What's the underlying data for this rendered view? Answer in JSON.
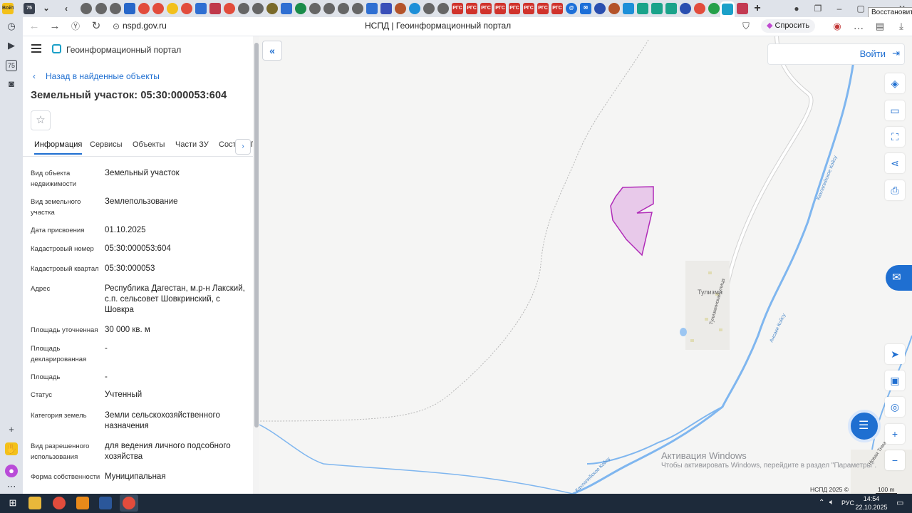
{
  "browser": {
    "url": "nspd.gov.ru",
    "page_title": "НСПД | Геоинформационный портал",
    "ask_button": "Спросить",
    "restore_tooltip": "Восстановить",
    "badge_text": "75",
    "login_small": "Войти"
  },
  "portal": {
    "name": "Геоинформационный портал",
    "back_link": "Назад в найденные объекты",
    "title": "Земельный участок: 05:30:000053:604",
    "tabs": [
      "Информация",
      "Сервисы",
      "Объекты",
      "Части ЗУ",
      "Соста",
      "П"
    ],
    "properties": [
      {
        "label": "Вид объекта недвижимости",
        "value": "Земельный участок"
      },
      {
        "label": "Вид земельного участка",
        "value": "Землепользование"
      },
      {
        "label": "Дата присвоения",
        "value": "01.10.2025"
      },
      {
        "label": "Кадастровый номер",
        "value": "05:30:000053:604"
      },
      {
        "label": "Кадастровый квартал",
        "value": "05:30:000053"
      },
      {
        "label": "Адрес",
        "value": "Республика Дагестан, м.р-н Лакский, с.п. сельсовет Шовкринский, с Шовкра"
      },
      {
        "label": "Площадь уточненная",
        "value": "30 000 кв. м"
      },
      {
        "label": "Площадь декларированная",
        "value": "-"
      },
      {
        "label": "Площадь",
        "value": "-"
      },
      {
        "label": "Статус",
        "value": "Учтенный"
      },
      {
        "label": "Категория земель",
        "value": "Земли сельскохозяйственного назначения"
      },
      {
        "label": "Вид разрешенного использования",
        "value": "для ведения личного подсобного хозяйства"
      },
      {
        "label": "Форма собственности",
        "value": "Муниципальная"
      }
    ]
  },
  "map": {
    "login": "Войти",
    "village_label": "Тулизма",
    "street_label": "Тулизминская улица",
    "river_label_1": "Кахлапийское Койсу",
    "river_label_2": "Ансаки Койсу",
    "river_label_3": "Новая Тима",
    "copyright": "НСПД 2025 ©",
    "scale": "100 m",
    "watermark_title": "Активация Windows",
    "watermark_text": "Чтобы активировать Windows, перейдите в раздел \"Параметры\".",
    "parcel_fill": "#e8c9ea",
    "parcel_stroke": "#b02bb8"
  },
  "taskbar": {
    "time": "14:54",
    "date": "22.10.2025",
    "lang": "РУС"
  },
  "colors": {
    "accent": "#1f6fd1",
    "river": "#7fb6ef",
    "taskbar": "#1d2a3a"
  }
}
